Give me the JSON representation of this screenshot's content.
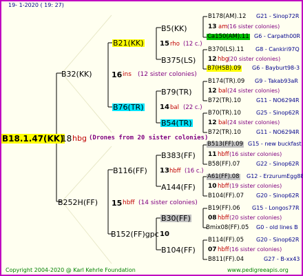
{
  "header": {
    "date": "19-  1-2020 ( 19: 27)"
  },
  "root": {
    "name": "B18.1.47(KK)",
    "count": "18",
    "code": "hbg",
    "note": "(Drones from 20 sister colonies)"
  },
  "gen1": [
    {
      "name": "B32(KK)",
      "count": "16",
      "code": "ins",
      "note": "(12 sister colonies)"
    },
    {
      "name": "B252H(FF)",
      "count": "15",
      "code": "hbff",
      "note": "(14 sister colonies)"
    }
  ],
  "gen2": [
    {
      "name": "B21(KK)",
      "count": "15",
      "code": "rho",
      "note": "(12 c.)"
    },
    {
      "name": "B76(TR)",
      "count": "14",
      "code": "bal",
      "note": "(22 c.)"
    },
    {
      "name": "B116(FF)",
      "count": "13",
      "code": "hbff",
      "note": "(16 c.)"
    },
    {
      "name": "B152(FF)gpc",
      "count": "10",
      "code": "",
      "note": ""
    }
  ],
  "gen3": [
    {
      "name": "B5(KK)"
    },
    {
      "name": "B375(LS)"
    },
    {
      "name": "B79(TR)"
    },
    {
      "name": "B54(TR)"
    },
    {
      "name": "B383(FF)"
    },
    {
      "name": "A144(FF)"
    },
    {
      "name": "B30(FF)"
    },
    {
      "name": "B104(FF)"
    }
  ],
  "gen4": [
    {
      "name": "B178(AM).12",
      "info": "G21 - Sinop72R"
    },
    {
      "name": "13",
      "code": "am",
      "note": "(16 sister colonies)"
    },
    {
      "name": "Ca150(AM).11",
      "info": "G6 - Carpath00R"
    },
    {
      "name": "B370(LS).11",
      "info": "G8 - Cankiri97Q"
    },
    {
      "name": "12",
      "code": "hbg",
      "note": "(20 sister colonies)"
    },
    {
      "name": "B7(HSB).09",
      "info": "G6 - Bayburt98-3"
    },
    {
      "name": "B174(TR).09",
      "info": "G9 - Takab93aR"
    },
    {
      "name": "12",
      "code": "bal",
      "note": "(24 sister colonies)"
    },
    {
      "name": "B72(TR).10",
      "info": "G11 - NO6294R"
    },
    {
      "name": "B70(TR).10",
      "info": "G25 - Sinop62R"
    },
    {
      "name": "12",
      "code": "bal",
      "note": "(24 sister colonies)"
    },
    {
      "name": "B72(TR).10",
      "info": "G11 - NO6294R"
    },
    {
      "name": "B513(FF).09",
      "info": "G15 - new buckfast"
    },
    {
      "name": "11",
      "code": "hbff",
      "note": "(16 sister colonies)"
    },
    {
      "name": "B58(FF).07",
      "info": "G22 - Sinop62R"
    },
    {
      "name": "A61(FF).08",
      "info": "G12 - ErzurumEgg88"
    },
    {
      "name": "10",
      "code": "hbff",
      "note": "(19 sister colonies)"
    },
    {
      "name": "B104(FF).07",
      "info": "G20 - Sinop62R"
    },
    {
      "name": "B19(FF).06",
      "info": "G15 - Longos77R"
    },
    {
      "name": "08",
      "code": "hbff",
      "note": "(20 sister colonies)"
    },
    {
      "name": "Bmix08(FF).05",
      "info": "G0 - old lines B"
    },
    {
      "name": "B114(FF).05",
      "info": "G20 - Sinop62R"
    },
    {
      "name": "07",
      "code": "hbff",
      "note": "(16 sister colonies)"
    },
    {
      "name": "B811(FF).04",
      "info": "G27 - B-xx43"
    }
  ],
  "footer": {
    "copyright": "Copyright 2004-2020 @ Karl Kehrle Foundation",
    "site": "www.pedigreeapis.org"
  }
}
